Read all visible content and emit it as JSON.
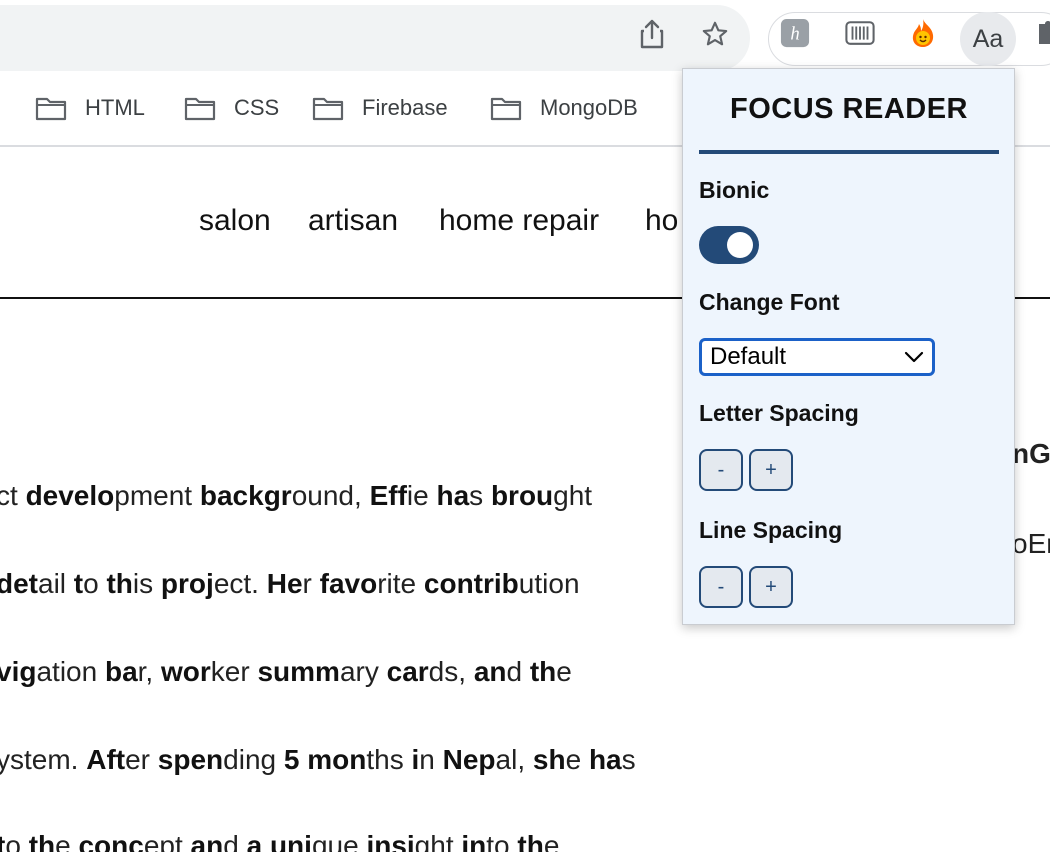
{
  "toolbar": {
    "share_icon": "share-icon",
    "bookmark_icon": "star-icon",
    "extensions": [
      "honey-icon",
      "barcode-icon",
      "fire-icon"
    ],
    "active_extension_label": "Aa"
  },
  "bookmarks": [
    {
      "label": "HTML"
    },
    {
      "label": "CSS"
    },
    {
      "label": "Firebase"
    },
    {
      "label": "MongoDB"
    }
  ],
  "site_nav": [
    "salon",
    "artisan",
    "home repair",
    "ho"
  ],
  "paragraph_lines": [
    [
      [
        "",
        "ct "
      ],
      [
        "b",
        "develo"
      ],
      [
        "",
        "pment "
      ],
      [
        "b",
        "backgr"
      ],
      [
        "",
        "ound, "
      ],
      [
        "b",
        "Eff"
      ],
      [
        "",
        "ie "
      ],
      [
        "b",
        "ha"
      ],
      [
        "",
        "s "
      ],
      [
        "b",
        "brou"
      ],
      [
        "",
        "ght"
      ]
    ],
    [
      [
        "",
        " "
      ],
      [
        "b",
        "det"
      ],
      [
        "",
        "ail "
      ],
      [
        "b",
        "t"
      ],
      [
        "",
        "o "
      ],
      [
        "b",
        "th"
      ],
      [
        "",
        "is "
      ],
      [
        "b",
        "proj"
      ],
      [
        "",
        "ect. "
      ],
      [
        "b",
        "He"
      ],
      [
        "",
        "r "
      ],
      [
        "b",
        "favo"
      ],
      [
        "",
        "rite "
      ],
      [
        "b",
        "contrib"
      ],
      [
        "",
        "ution"
      ]
    ],
    [
      [
        "b",
        "vig"
      ],
      [
        "",
        "ation "
      ],
      [
        "b",
        "ba"
      ],
      [
        "",
        "r, "
      ],
      [
        "b",
        "wor"
      ],
      [
        "",
        "ker "
      ],
      [
        "b",
        "summ"
      ],
      [
        "",
        "ary "
      ],
      [
        "b",
        "car"
      ],
      [
        "",
        "ds, "
      ],
      [
        "b",
        "an"
      ],
      [
        "",
        "d "
      ],
      [
        "b",
        "th"
      ],
      [
        "",
        "e"
      ]
    ],
    [
      [
        "",
        "ystem. "
      ],
      [
        "b",
        "Aft"
      ],
      [
        "",
        "er "
      ],
      [
        "b",
        "spen"
      ],
      [
        "",
        "ding "
      ],
      [
        "b",
        "5 mon"
      ],
      [
        "",
        "ths "
      ],
      [
        "b",
        "i"
      ],
      [
        "",
        "n "
      ],
      [
        "b",
        "Nep"
      ],
      [
        "",
        "al, "
      ],
      [
        "b",
        "sh"
      ],
      [
        "",
        "e "
      ],
      [
        "b",
        "ha"
      ],
      [
        "",
        "s"
      ]
    ],
    [
      [
        "",
        " "
      ],
      [
        "b",
        "t"
      ],
      [
        "",
        "o "
      ],
      [
        "b",
        "th"
      ],
      [
        "",
        "e "
      ],
      [
        "b",
        "conc"
      ],
      [
        "",
        "ept "
      ],
      [
        "b",
        "an"
      ],
      [
        "",
        "d "
      ],
      [
        "b",
        "a uni"
      ],
      [
        "",
        "que "
      ],
      [
        "b",
        "insi"
      ],
      [
        "",
        "ght "
      ],
      [
        "b",
        "in"
      ],
      [
        "",
        "to "
      ],
      [
        "b",
        "th"
      ],
      [
        "",
        "e"
      ]
    ]
  ],
  "side_fragments": [
    "nGi",
    "oEr"
  ],
  "popup": {
    "title": "FOCUS READER",
    "bionic_label": "Bionic",
    "bionic_on": true,
    "font_label": "Change Font",
    "font_selected": "Default",
    "letter_spacing_label": "Letter Spacing",
    "line_spacing_label": "Line Spacing",
    "minus": "-",
    "plus": "+"
  },
  "colors": {
    "accent": "#234a78",
    "popup_bg": "#eef5fd",
    "select_border": "#1b61c8"
  }
}
